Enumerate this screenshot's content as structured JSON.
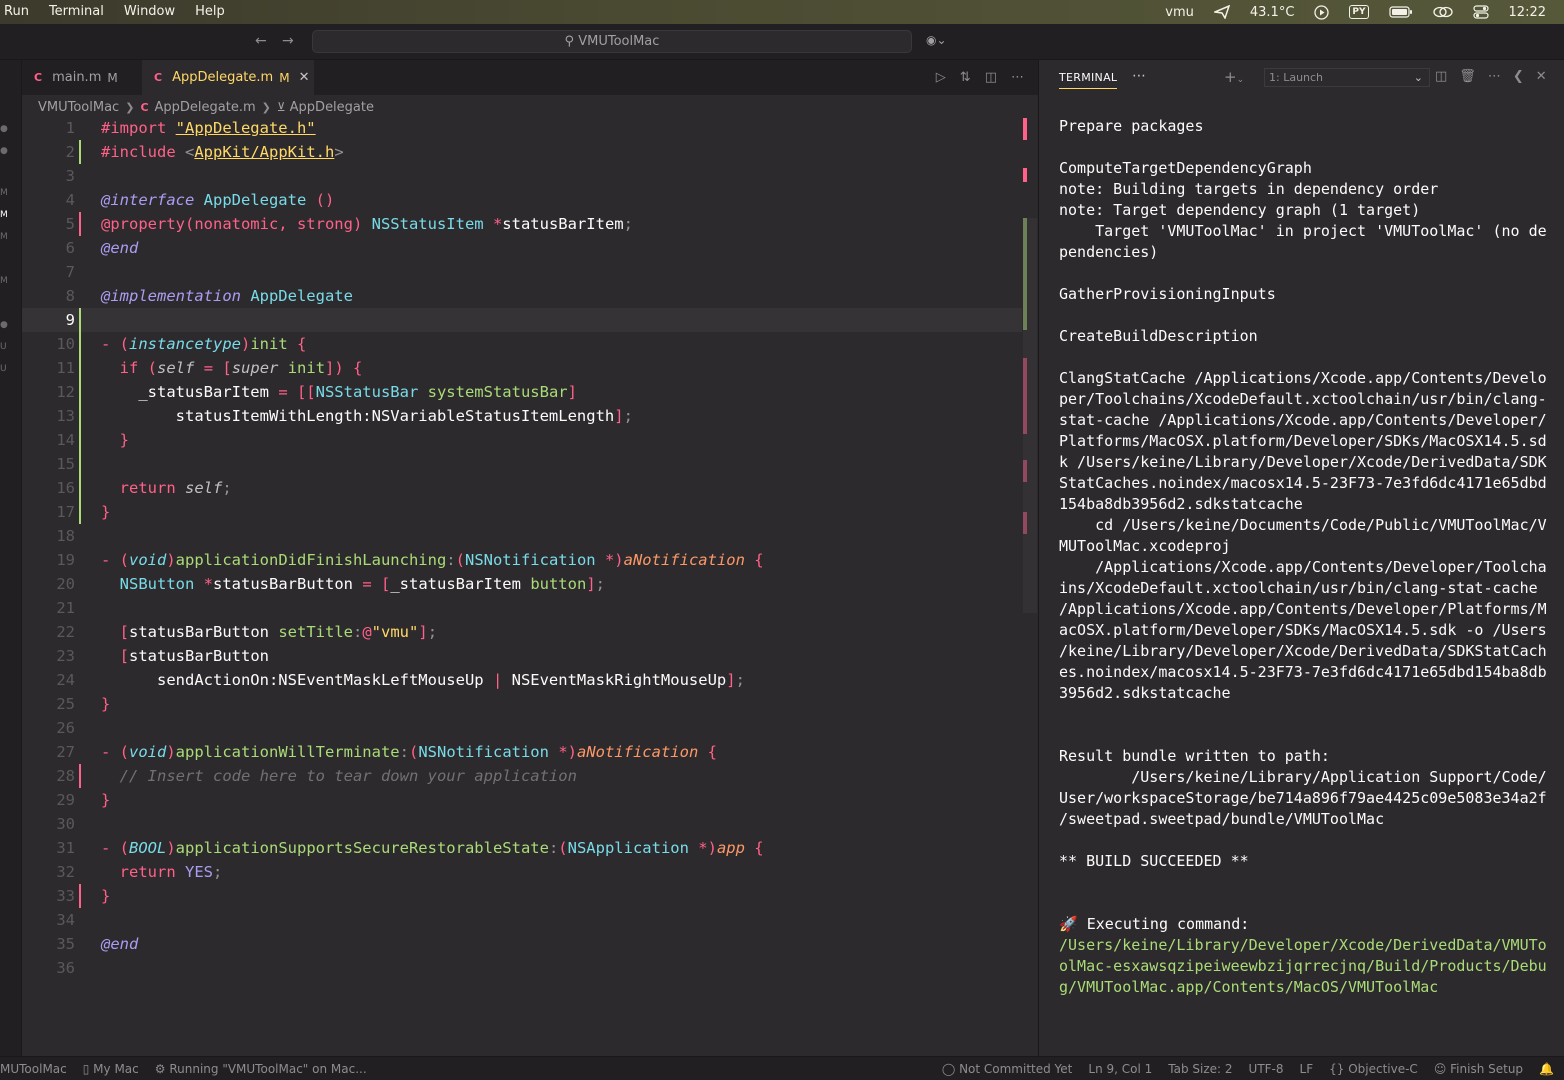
{
  "menubar": {
    "items": [
      "Run",
      "Terminal",
      "Window",
      "Help"
    ],
    "user": "vmu",
    "temperature": "43.1°C",
    "py_badge": "PY",
    "clock": "12:22"
  },
  "titlebar": {
    "search": "VMUToolMac"
  },
  "tabs": [
    {
      "label": "main.m",
      "modified": "M"
    },
    {
      "label": "AppDelegate.m",
      "modified": "M"
    }
  ],
  "breadcrumb": [
    "VMUToolMac",
    "AppDelegate.m",
    "AppDelegate"
  ],
  "editor": {
    "lines": [
      [
        [
          "kw",
          "#import "
        ],
        [
          "stu",
          "\"AppDelegate.h\""
        ]
      ],
      [
        [
          "kw",
          "#include "
        ],
        [
          "pu",
          "<"
        ],
        [
          "stu",
          "AppKit/AppKit.h"
        ],
        [
          "pu",
          ">"
        ]
      ],
      [],
      [
        [
          "at",
          "@interface "
        ],
        [
          "ty",
          "AppDelegate "
        ],
        [
          "kw",
          "()"
        ]
      ],
      [
        [
          "kw",
          "@property(nonatomic, strong) "
        ],
        [
          "ty",
          "NSStatusItem "
        ],
        [
          "kw",
          "*"
        ],
        [
          "pl",
          "statusBarItem"
        ],
        [
          "pu",
          ";"
        ]
      ],
      [
        [
          "at",
          "@end"
        ]
      ],
      [],
      [
        [
          "at",
          "@implementation "
        ],
        [
          "ty",
          "AppDelegate"
        ]
      ],
      [],
      [
        [
          "kw",
          "- "
        ],
        [
          "kw",
          "("
        ],
        [
          "tyi",
          "instancetype"
        ],
        [
          "kw",
          ")"
        ],
        [
          "fn",
          "init "
        ],
        [
          "kw",
          "{"
        ]
      ],
      [
        [
          "pl",
          "  "
        ],
        [
          "kw",
          "if "
        ],
        [
          "kw",
          "("
        ],
        [
          "sf",
          "self "
        ],
        [
          "kw",
          "= "
        ],
        [
          "kw",
          "["
        ],
        [
          "sf",
          "super "
        ],
        [
          "fn",
          "init"
        ],
        [
          "kw",
          "]) {"
        ]
      ],
      [
        [
          "pl",
          "    _statusBarItem "
        ],
        [
          "kw",
          "= [["
        ],
        [
          "ty",
          "NSStatusBar "
        ],
        [
          "fn",
          "systemStatusBar"
        ],
        [
          "kw",
          "]"
        ]
      ],
      [
        [
          "pl",
          "        statusItemWithLength:NSVariableStatusItemLength"
        ],
        [
          "kw",
          "]"
        ],
        [
          "pu",
          ";"
        ]
      ],
      [
        [
          "pl",
          "  "
        ],
        [
          "kw",
          "}"
        ]
      ],
      [],
      [
        [
          "pl",
          "  "
        ],
        [
          "kw",
          "return "
        ],
        [
          "sf",
          "self"
        ],
        [
          "pu",
          ";"
        ]
      ],
      [
        [
          "kw",
          "}"
        ]
      ],
      [],
      [
        [
          "kw",
          "- ("
        ],
        [
          "tyi",
          "void"
        ],
        [
          "kw",
          ")"
        ],
        [
          "fn",
          "applicationDidFinishLaunching"
        ],
        [
          "pu",
          ":"
        ],
        [
          "kw",
          "("
        ],
        [
          "ty",
          "NSNotification "
        ],
        [
          "kw",
          "*)"
        ],
        [
          "pa",
          "aNotification "
        ],
        [
          "kw",
          "{"
        ]
      ],
      [
        [
          "pl",
          "  "
        ],
        [
          "ty",
          "NSButton "
        ],
        [
          "kw",
          "*"
        ],
        [
          "pl",
          "statusBarButton "
        ],
        [
          "kw",
          "= ["
        ],
        [
          "pl",
          "_statusBarItem "
        ],
        [
          "fn",
          "button"
        ],
        [
          "kw",
          "]"
        ],
        [
          "pu",
          ";"
        ]
      ],
      [],
      [
        [
          "pl",
          "  "
        ],
        [
          "kw",
          "["
        ],
        [
          "pl",
          "statusBarButton "
        ],
        [
          "fn",
          "setTitle"
        ],
        [
          "pu",
          ":"
        ],
        [
          "kw",
          "@"
        ],
        [
          "st",
          "\"vmu\""
        ],
        [
          "kw",
          "]"
        ],
        [
          "pu",
          ";"
        ]
      ],
      [
        [
          "pl",
          "  "
        ],
        [
          "kw",
          "["
        ],
        [
          "pl",
          "statusBarButton"
        ]
      ],
      [
        [
          "pl",
          "      sendActionOn:NSEventMaskLeftMouseUp "
        ],
        [
          "kw",
          "| "
        ],
        [
          "pl",
          "NSEventMaskRightMouseUp"
        ],
        [
          "kw",
          "]"
        ],
        [
          "pu",
          ";"
        ]
      ],
      [
        [
          "kw",
          "}"
        ]
      ],
      [],
      [
        [
          "kw",
          "- ("
        ],
        [
          "tyi",
          "void"
        ],
        [
          "kw",
          ")"
        ],
        [
          "fn",
          "applicationWillTerminate"
        ],
        [
          "pu",
          ":"
        ],
        [
          "kw",
          "("
        ],
        [
          "ty",
          "NSNotification "
        ],
        [
          "kw",
          "*)"
        ],
        [
          "pa",
          "aNotification "
        ],
        [
          "kw",
          "{"
        ]
      ],
      [
        [
          "pl",
          "  "
        ],
        [
          "cm",
          "// Insert code here to tear down your application"
        ]
      ],
      [
        [
          "kw",
          "}"
        ]
      ],
      [],
      [
        [
          "kw",
          "- ("
        ],
        [
          "tyi",
          "BOOL"
        ],
        [
          "kw",
          ")"
        ],
        [
          "fn",
          "applicationSupportsSecureRestorableState"
        ],
        [
          "pu",
          ":"
        ],
        [
          "kw",
          "("
        ],
        [
          "ty",
          "NSApplication "
        ],
        [
          "kw",
          "*)"
        ],
        [
          "pa",
          "app "
        ],
        [
          "kw",
          "{"
        ]
      ],
      [
        [
          "pl",
          "  "
        ],
        [
          "kw",
          "return "
        ],
        [
          "nu",
          "YES"
        ],
        [
          "pu",
          ";"
        ]
      ],
      [
        [
          "kw",
          "}"
        ]
      ],
      [],
      [
        [
          "at",
          "@end"
        ]
      ],
      []
    ]
  },
  "terminal": {
    "title": "TERMINAL",
    "selector": "1: Launch",
    "lines": [
      "Prepare packages",
      "",
      "ComputeTargetDependencyGraph",
      "note: Building targets in dependency order",
      "note: Target dependency graph (1 target)",
      "    Target 'VMUToolMac' in project 'VMUToolMac' (no de",
      "pendencies)",
      "",
      "GatherProvisioningInputs",
      "",
      "CreateBuildDescription",
      "",
      "ClangStatCache /Applications/Xcode.app/Contents/Develo",
      "per/Toolchains/XcodeDefault.xctoolchain/usr/bin/clang-",
      "stat-cache /Applications/Xcode.app/Contents/Developer/",
      "Platforms/MacOSX.platform/Developer/SDKs/MacOSX14.5.sd",
      "k /Users/keine/Library/Developer/Xcode/DerivedData/SDK",
      "StatCaches.noindex/macosx14.5-23F73-7e3fd6dc4171e65dbd",
      "154ba8db3956d2.sdkstatcache",
      "    cd /Users/keine/Documents/Code/Public/VMUToolMac/V",
      "MUToolMac.xcodeproj",
      "    /Applications/Xcode.app/Contents/Developer/Toolcha",
      "ins/XcodeDefault.xctoolchain/usr/bin/clang-stat-cache",
      "/Applications/Xcode.app/Contents/Developer/Platforms/M",
      "acOSX.platform/Developer/SDKs/MacOSX14.5.sdk -o /Users",
      "/keine/Library/Developer/Xcode/DerivedData/SDKStatCach",
      "es.noindex/macosx14.5-23F73-7e3fd6dc4171e65dbd154ba8db",
      "3956d2.sdkstatcache",
      "",
      "",
      "Result bundle written to path:",
      "        /Users/keine/Library/Application Support/Code/",
      "User/workspaceStorage/be714a896f79ae4425c09e5083e34a2f",
      "/sweetpad.sweetpad/bundle/VMUToolMac",
      "",
      "** BUILD SUCCEEDED **",
      "",
      "",
      "🚀 Executing command:"
    ],
    "exec_lines": [
      "/Users/keine/Library/Developer/Xcode/DerivedData/VMUTo",
      "olMac-esxawsqzipeiweewbzijqrrecjnq/Build/Products/Debu",
      "g/VMUToolMac.app/Contents/MacOS/VMUToolMac"
    ]
  },
  "status": {
    "left": [
      "MUToolMac",
      "My Mac",
      "Running \"VMUToolMac\" on Mac..."
    ],
    "right": [
      "Not Committed Yet",
      "Ln 9, Col 1",
      "Tab Size: 2",
      "UTF-8",
      "LF",
      "Objective-C",
      "Finish Setup"
    ]
  },
  "colors": {
    "background": "#2d2a2e",
    "accent": "#ffd866",
    "keyword": "#ff6188",
    "type": "#78dce8",
    "function": "#a9dc76"
  }
}
